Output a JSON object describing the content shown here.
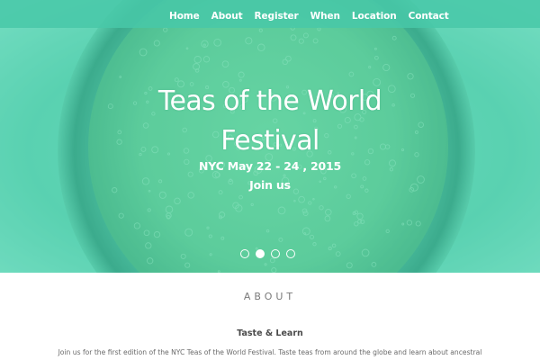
{
  "nav": {
    "items": [
      {
        "label": "Home"
      },
      {
        "label": "About"
      },
      {
        "label": "Register"
      },
      {
        "label": "When"
      },
      {
        "label": "Location"
      },
      {
        "label": "Contact"
      }
    ]
  },
  "hero": {
    "title_line1": "Teas of the World",
    "title_line2": "Festival",
    "date": "NYC May 22 - 24 , 2015",
    "join_label": "Join us",
    "carousel": {
      "slide_count": 4,
      "active_index": 1
    }
  },
  "about": {
    "heading": "ABOUT",
    "subheading": "Taste & Learn",
    "body": "Join us for the first edition of the NYC Teas of the World Festival. Taste teas from around the globe and learn about ancestral"
  },
  "colors": {
    "accent": "#5fd4b4",
    "nav_bg": "#48c8a8",
    "hero_text": "#ffffff",
    "heading_text": "#7a7a7a"
  }
}
